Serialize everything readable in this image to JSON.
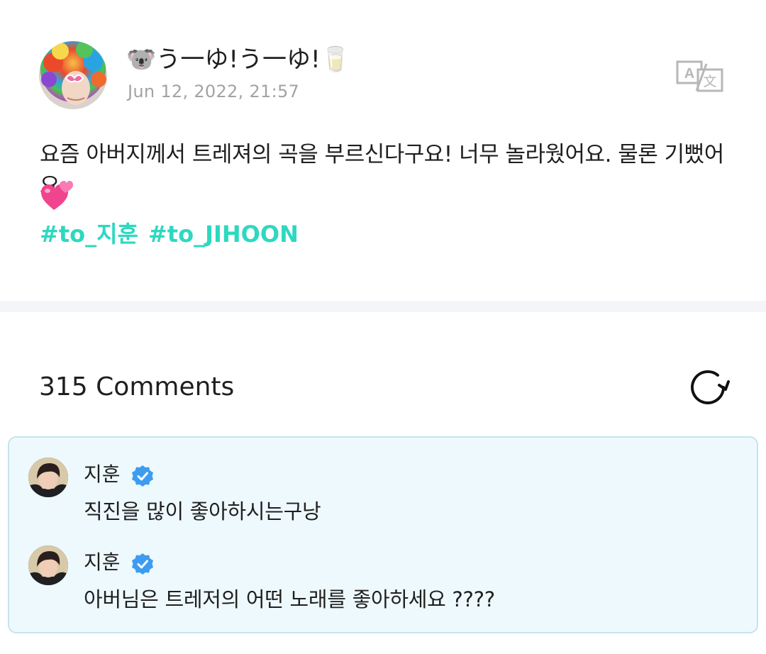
{
  "post": {
    "author_name": "🐨う一ゆ!う一ゆ!🥛",
    "date": "Jun 12, 2022, 21:57",
    "body": "요즘 아버지께서 트레져의 곡을 부르신다구요! 너무 놀라웠어요. 물론 기뻤어요",
    "hashtags": [
      "#to_지훈",
      "#to_JIHOON"
    ],
    "icons": {
      "translate": "translate-icon",
      "emoji": "two-hearts-emoji"
    }
  },
  "comments": {
    "count_label": "315 Comments",
    "refresh_icon": "refresh-icon",
    "items": [
      {
        "name": "지훈",
        "text": "직진을 많이 좋아하시는구낭"
      },
      {
        "name": "지훈",
        "text": "아버님은 트레저의 어떤 노래를 좋아하세요 ????"
      }
    ]
  },
  "colors": {
    "hashtag": "#2ed8c0",
    "date": "#a3a3a3",
    "comment_bg": "#eef9fd",
    "comment_border": "#c6e4ee",
    "verified": "#3d9cf0",
    "divider": "#f4f5f9"
  }
}
